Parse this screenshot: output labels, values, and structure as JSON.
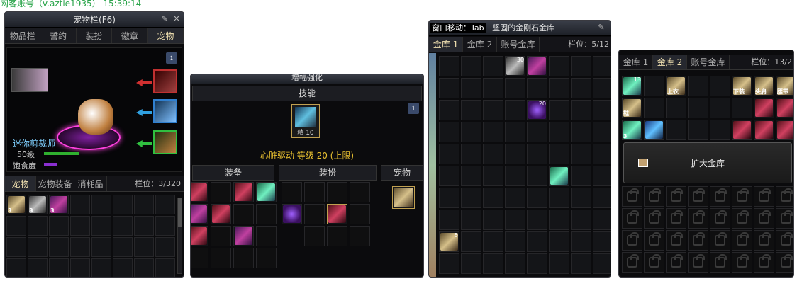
{
  "caption": "网客账号（v.aztie1935） 15:39:14",
  "pet_window": {
    "title": "宠物栏(F6)",
    "tabs": [
      "物品栏",
      "誓约",
      "装扮",
      "徽章",
      "宠物"
    ],
    "pet_name": "迷你剪裁师",
    "level": "50级",
    "hunger": "饱食度",
    "subtabs": [
      "宠物",
      "宠物装备",
      "消耗品"
    ],
    "slots_label": "栏位：3/320",
    "info": "i",
    "badges": [
      "3",
      "3",
      "3"
    ]
  },
  "enhance_window": {
    "title": "增幅强化",
    "skill_header": "技能",
    "skill_label": "精 10",
    "skill_desc": "心脏驱动 等级 20 (上限)",
    "col_equip": "装备",
    "col_avatar": "装扮",
    "col_pet": "宠物",
    "info": "i"
  },
  "vault_window": {
    "title_prefix": "窗口移动：Tab",
    "title": "坚固的金刚石金库",
    "tabs": [
      "金库 1",
      "金库 2",
      "账号金库"
    ],
    "slots_label": "栏位：5/12",
    "counts": [
      "30",
      "20"
    ],
    "badge": "5"
  },
  "vault2_window": {
    "tabs": [
      "金库 1",
      "金库 2",
      "账号金库"
    ],
    "slots_label": "栏位：13/2",
    "count": "13",
    "item_tags": [
      "上衣",
      "下装",
      "头肩",
      "腰带",
      "鞋"
    ],
    "expand_label": "扩大金库",
    "badges": [
      "3"
    ]
  },
  "colors": {
    "accent": "#f0e0b0",
    "hp_green": "#2fb02f",
    "hunger_purple": "#8a2fd0",
    "frame": "#3a3a40"
  }
}
